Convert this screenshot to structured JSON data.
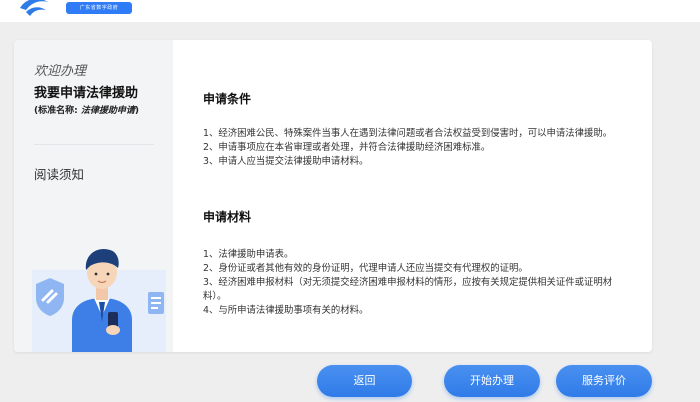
{
  "header": {
    "logo_tag": "广东省数字政府"
  },
  "sidebar": {
    "welcome": "欢迎办理",
    "service_title": "我要申请法律援助",
    "std_name_prefix": "(标准名称: ",
    "std_name_value": "法律援助申请",
    "std_name_suffix": ")",
    "menu_item": "阅读须知"
  },
  "content": {
    "conditions_title": "申请条件",
    "conditions": [
      "1、经济困难公民、特殊案件当事人在遇到法律问题或者合法权益受到侵害时，可以申请法律援助。",
      "2、申请事项应在本省审理或者处理，并符合法律援助经济困难标准。",
      "3、申请人应当提交法律援助申请材料。"
    ],
    "materials_title": "申请材料",
    "materials": [
      "1、法律援助申请表。",
      "2、身份证或者其他有效的身份证明，代理申请人还应当提交有代理权的证明。",
      "3、经济困难申报材料（对无须提交经济困难申报材料的情形，应按有关规定提供相关证件或证明材料）。",
      "4、与所申请法律援助事项有关的材料。"
    ]
  },
  "buttons": {
    "back": "返回",
    "start": "开始办理",
    "evaluate": "服务评价"
  },
  "colors": {
    "accent": "#2f7be8",
    "sidebar_bg": "#f3f4f6",
    "page_bg": "#eeeeef"
  }
}
